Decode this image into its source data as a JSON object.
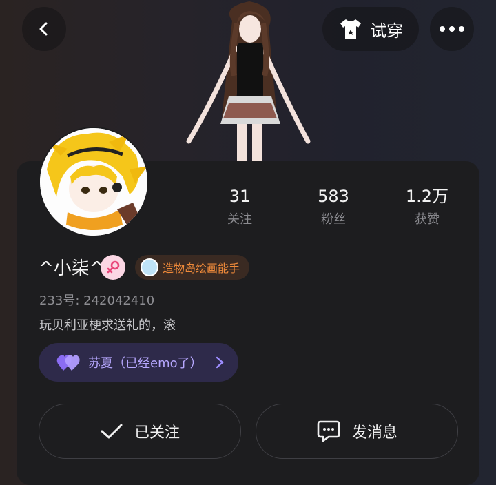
{
  "header": {
    "back_icon": "back-arrow-icon",
    "try_on_label": "试穿",
    "try_on_icon": "tshirt-icon",
    "more_icon": "more-dots-icon"
  },
  "profile": {
    "username": "^小柒^",
    "gender": "female",
    "badge_label": "造物岛绘画能手",
    "id_line": "233号: 242042410",
    "bio": "玩贝利亚梗求送礼的，滚"
  },
  "stats": [
    {
      "value": "31",
      "label": "关注"
    },
    {
      "value": "583",
      "label": "粉丝"
    },
    {
      "value": "1.2万",
      "label": "获赞"
    }
  ],
  "relationship": {
    "label": "苏夏（已经emo了）",
    "icon": "double-heart-icon"
  },
  "actions": {
    "follow_label": "已关注",
    "follow_icon": "checkmark-icon",
    "message_label": "发消息",
    "message_icon": "message-bubble-icon"
  },
  "colors": {
    "card_bg": "#1d1d1f",
    "badge_text": "#ef8a3a",
    "emo_text": "#b7a8ff",
    "emo_bg": "#2e2a4a"
  }
}
